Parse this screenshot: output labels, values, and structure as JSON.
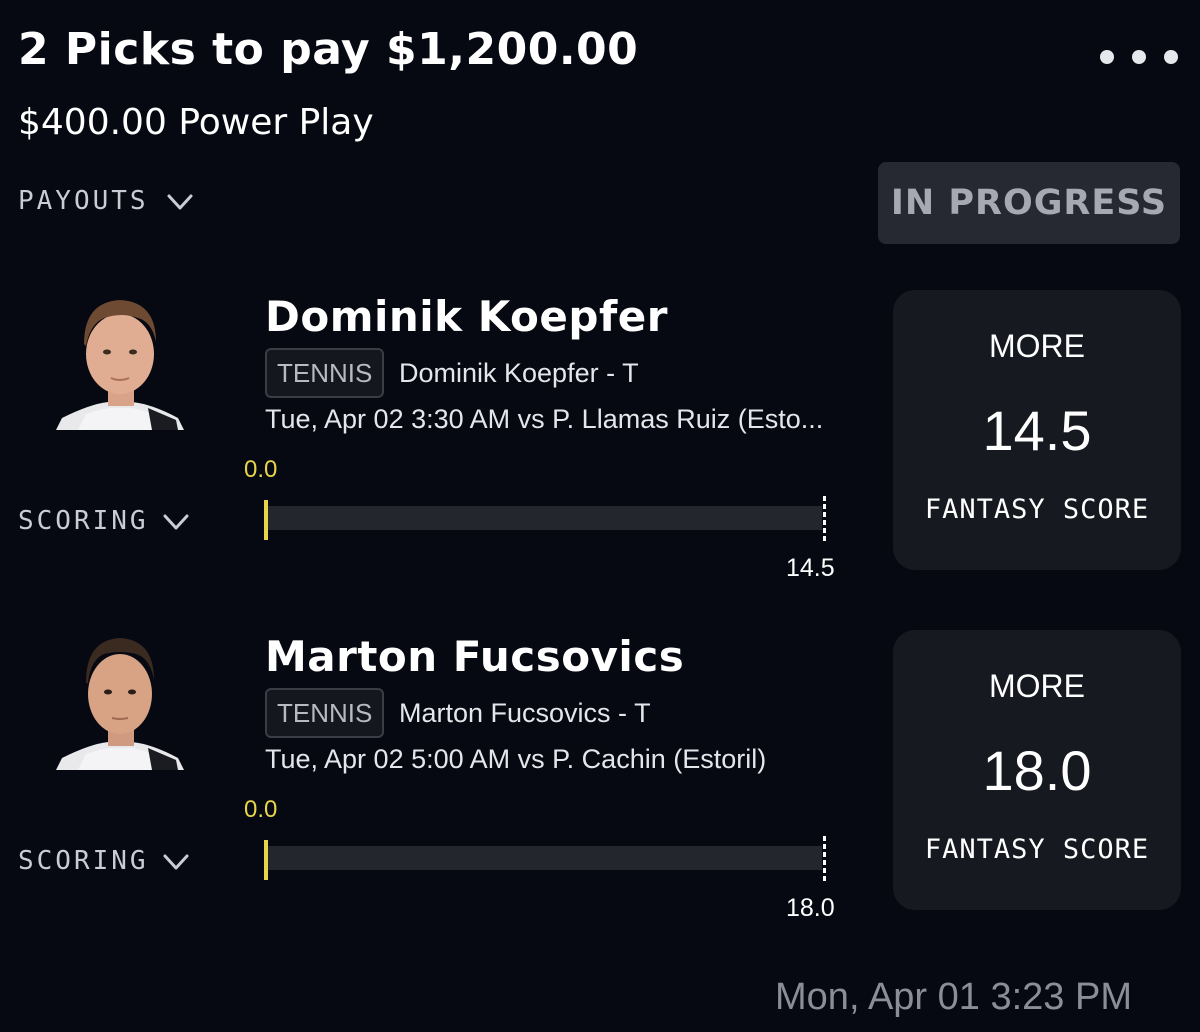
{
  "header": {
    "title": "2 Picks to pay $1,200.00",
    "subtitle": "$400.00 Power Play",
    "payouts_label": "PAYOUTS",
    "status": "IN PROGRESS"
  },
  "picks": [
    {
      "name": "Dominik Koepfer",
      "sport": "TENNIS",
      "stat_label": "Dominik Koepfer - T",
      "game": "Tue, Apr 02 3:30 AM  vs P. Llamas Ruiz (Esto...",
      "current": "0.0",
      "progress": 0,
      "target": "14.5",
      "scoring_label": "SCORING",
      "direction": "MORE",
      "line": "14.5",
      "stat_type": "FANTASY SCORE"
    },
    {
      "name": "Marton Fucsovics",
      "sport": "TENNIS",
      "stat_label": "Marton Fucsovics - T",
      "game": "Tue, Apr 02 5:00 AM  vs P. Cachin (Estoril)",
      "current": "0.0",
      "progress": 0,
      "target": "18.0",
      "scoring_label": "SCORING",
      "direction": "MORE",
      "line": "18.0",
      "stat_type": "FANTASY SCORE"
    }
  ],
  "footer": {
    "timestamp": "Mon, Apr 01 3:23 PM"
  },
  "colors": {
    "background": "#060911",
    "accent_yellow": "#e8d44a",
    "card": "#161920",
    "badge": "#262932"
  },
  "icons": {
    "more": "more-horizontal-icon",
    "chevron": "chevron-down-icon",
    "avatar": "player-headshot"
  }
}
